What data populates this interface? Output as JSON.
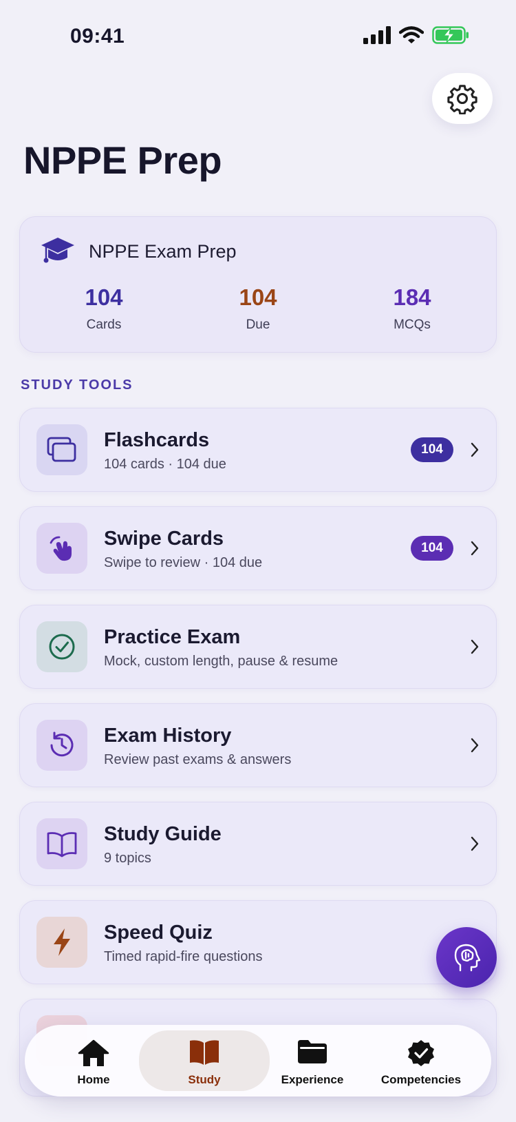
{
  "status_bar": {
    "time": "09:41"
  },
  "header": {
    "title": "NPPE Prep"
  },
  "summary": {
    "title": "NPPE Exam Prep",
    "stats": [
      {
        "value": "104",
        "label": "Cards",
        "color": "#3d2fa0"
      },
      {
        "value": "104",
        "label": "Due",
        "color": "#9a4516"
      },
      {
        "value": "184",
        "label": "MCQs",
        "color": "#5b2db3"
      }
    ]
  },
  "section": {
    "label": "STUDY TOOLS"
  },
  "tools": [
    {
      "title": "Flashcards",
      "subtitle": "104 cards · 104 due",
      "badge": "104",
      "icon": "cards-icon"
    },
    {
      "title": "Swipe Cards",
      "subtitle": "Swipe to review · 104 due",
      "badge": "104",
      "icon": "hand-swipe-icon"
    },
    {
      "title": "Practice Exam",
      "subtitle": "Mock, custom length, pause & resume",
      "icon": "check-circle-icon"
    },
    {
      "title": "Exam History",
      "subtitle": "Review past exams & answers",
      "icon": "history-clock-icon"
    },
    {
      "title": "Study Guide",
      "subtitle": "9 topics",
      "icon": "open-book-icon"
    },
    {
      "title": "Speed Quiz",
      "subtitle": "Timed rapid-fire questions",
      "icon": "lightning-icon"
    }
  ],
  "tab_bar": {
    "tabs": [
      {
        "label": "Home",
        "icon": "home-icon"
      },
      {
        "label": "Study",
        "icon": "book-icon",
        "active": true
      },
      {
        "label": "Experience",
        "icon": "folder-icon"
      },
      {
        "label": "Competencies",
        "icon": "verified-badge-icon"
      }
    ]
  },
  "colors": {
    "accent_indigo": "#3d2fa0",
    "accent_purple": "#5b2db3",
    "due_orange": "#9a4516",
    "active_tab": "#8a2f0a",
    "battery_green": "#34c759"
  }
}
